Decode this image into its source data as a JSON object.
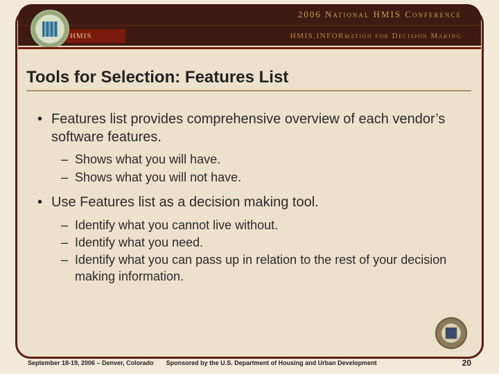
{
  "header": {
    "line1": "2006 National HMIS Conference",
    "line2": "HMIS.INFORmation for Decision Making",
    "ribbon": "HMIS"
  },
  "title": "Tools for Selection: Features List",
  "bullets": [
    {
      "text": "Features list provides comprehensive overview of each vendor’s software features.",
      "sub": [
        "Shows what you will have.",
        "Shows what you will not have."
      ]
    },
    {
      "text": "Use Features list as a decision making tool.",
      "sub": [
        "Identify what you cannot live without.",
        "Identify what you need.",
        "Identify what you can pass up in relation to the rest of your decision making information."
      ]
    }
  ],
  "footer": {
    "left": "September 18-19, 2006 – Denver, Colorado",
    "center": "Sponsored by the U.S. Department of Housing and Urban Development",
    "page": "20"
  }
}
